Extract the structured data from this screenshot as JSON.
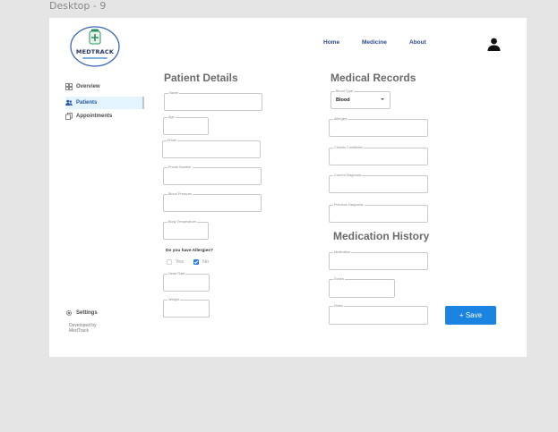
{
  "frame_label": "Desktop - 9",
  "logo": {
    "title": "MEDTRACK",
    "tagline": "Your health, your records"
  },
  "nav": {
    "home": "Home",
    "medicine": "Medicine",
    "about": "About"
  },
  "icons": {
    "user": "user-icon",
    "overview": "grid-icon",
    "patients": "users-icon",
    "appointments": "copy-icon",
    "settings": "gear-icon"
  },
  "sidebar": {
    "overview": "Overview",
    "patients": "Patients",
    "appointments": "Appointments",
    "settings": "Settings",
    "developed_by": "Developed by MedTrack"
  },
  "patient_details": {
    "title": "Patient Details",
    "name_label": "Name",
    "age_label": "Age",
    "email_label": "Email",
    "phone_label": "Phone Number",
    "bp_label": "Blood Pressure",
    "temp_label": "Body Temperature",
    "allergy_question": "Do you have Allergies?",
    "yes_label": "Yes",
    "no_label": "No",
    "yes_checked": false,
    "no_checked": true,
    "heart_rate_label": "Heart Rate",
    "weight_label": "Weight"
  },
  "medical_records": {
    "title": "Medical Records",
    "blood_type_label": "Blood Type",
    "blood_type_value": "Blood",
    "allergies_label": "Allergies",
    "chronic_label": "Chronic Conditions",
    "current_diag_label": "Current Diagnosis",
    "previous_diag_label": "Previous Diagnosis"
  },
  "medication_history": {
    "title": "Medication History",
    "medication_label": "Medication",
    "doses_label": "Doses",
    "notes_label": "Notes"
  },
  "save_button": "+ Save",
  "colors": {
    "accent": "#1a84e0",
    "nav": "#2c4a8f",
    "active_bg": "#e3f4fc"
  }
}
